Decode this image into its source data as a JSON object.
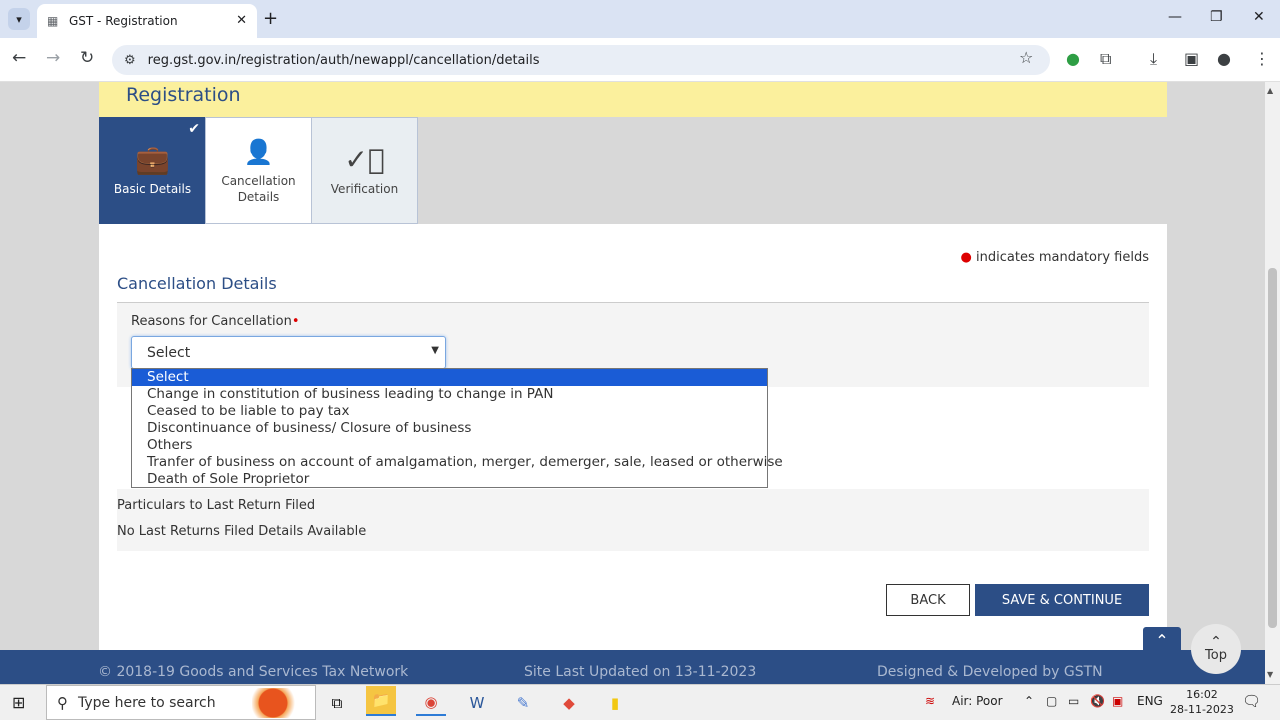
{
  "browser": {
    "tab_title": "GST - Registration",
    "url": "reg.gst.gov.in/registration/auth/newappl/cancellation/details"
  },
  "page": {
    "banner_title": "Registration",
    "steps": [
      {
        "label": "Basic Details",
        "icon": "briefcase-icon",
        "state": "completed"
      },
      {
        "label": "Cancellation Details",
        "icon": "user-check-icon",
        "state": "active"
      },
      {
        "label": "Verification",
        "icon": "check-circle-icon",
        "state": "pending"
      }
    ],
    "mandatory_note": "indicates mandatory fields",
    "section_title": "Cancellation Details",
    "reason_label": "Reasons for Cancellation",
    "reason_value": "Select",
    "reason_options": [
      "Select",
      "Change in constitution of business leading to change in PAN",
      "Ceased to be liable to pay tax",
      "Discontinuance of business/ Closure of business",
      "Others",
      "Tranfer of business on account of amalgamation, merger, demerger, sale, leased or otherwise",
      "Death of Sole Proprietor"
    ],
    "selected_option_index": 0,
    "last_return_label": "Particulars to Last Return Filed",
    "last_return_value": "No Last Returns Filed Details Available",
    "back_label": "BACK",
    "save_label": "SAVE & CONTINUE",
    "top_label": "Top",
    "footer": {
      "copyright": "© 2018-19 Goods and Services Tax Network",
      "updated": "Site Last Updated on 13-11-2023",
      "designed": "Designed & Developed by GSTN"
    }
  },
  "taskbar": {
    "search_placeholder": "Type here to search",
    "air_quality": "Air: Poor",
    "language": "ENG",
    "time": "16:02",
    "date": "28-11-2023"
  },
  "colors": {
    "brand_blue": "#2c4e86",
    "banner_yellow": "#fbf09d",
    "selected_option": "#1a5cd6"
  }
}
